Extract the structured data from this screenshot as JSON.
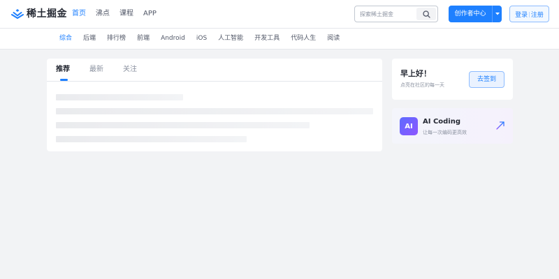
{
  "header": {
    "logo_text": "稀土掘金",
    "nav": [
      {
        "label": "首页",
        "active": true
      },
      {
        "label": "沸点",
        "active": false
      },
      {
        "label": "课程",
        "active": false
      },
      {
        "label": "APP",
        "active": false
      }
    ],
    "search": {
      "placeholder": "探索稀土掘金",
      "value": ""
    },
    "creator_label": "创作者中心",
    "login_label": "登录",
    "login_sep": "|",
    "register_label": "注册"
  },
  "categories": [
    {
      "label": "综合",
      "active": true
    },
    {
      "label": "后端",
      "active": false
    },
    {
      "label": "排行榜",
      "active": false
    },
    {
      "label": "前端",
      "active": false
    },
    {
      "label": "Android",
      "active": false
    },
    {
      "label": "iOS",
      "active": false
    },
    {
      "label": "人工智能",
      "active": false
    },
    {
      "label": "开发工具",
      "active": false
    },
    {
      "label": "代码人生",
      "active": false
    },
    {
      "label": "阅读",
      "active": false
    }
  ],
  "feed": {
    "tabs": [
      {
        "label": "推荐",
        "active": true
      },
      {
        "label": "最新",
        "active": false
      },
      {
        "label": "关注",
        "active": false
      }
    ]
  },
  "checkin": {
    "greeting": "早上好！",
    "subtitle": "点亮在社区的每一天",
    "button_label": "去签到"
  },
  "ai_card": {
    "logo_text": "AI",
    "title": "AI Coding",
    "subtitle": "让每一次编码更高效"
  },
  "colors": {
    "accent": "#1e80ff",
    "background": "#f2f3f5",
    "text_primary": "#252933",
    "text_secondary": "#8a919f"
  },
  "icons": {
    "logo": "juejin-logo-icon",
    "search": "search-icon",
    "dropdown": "caret-down-icon",
    "ai_arrow": "arrow-up-right-icon"
  }
}
